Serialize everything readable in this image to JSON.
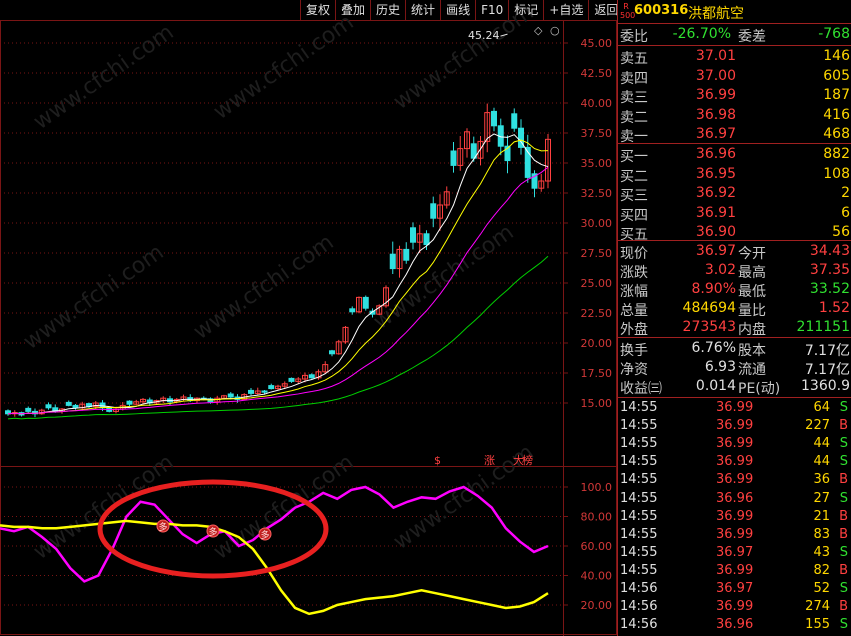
{
  "toolbar": {
    "buttons": [
      "复权",
      "叠加",
      "历史",
      "统计",
      "画线",
      "F10",
      "标记",
      "+自选",
      "返回"
    ]
  },
  "chart": {
    "price_axis": [
      "45.00",
      "42.50",
      "40.00",
      "37.50",
      "35.00",
      "32.50",
      "30.00",
      "27.50",
      "25.00",
      "22.50",
      "20.00",
      "17.50",
      "15.00"
    ],
    "indicator_axis": [
      "100.0",
      "80.00",
      "60.00",
      "40.00",
      "20.00"
    ],
    "high_label": "45.24",
    "markers": [
      "$",
      "涨",
      "大",
      "榜"
    ],
    "signal_label": "多",
    "watermark": "www.cfchi.com"
  },
  "chart_data": {
    "type": "line",
    "candle_closes": [
      14.1,
      14.2,
      14.0,
      14.3,
      14.1,
      14.4,
      14.6,
      14.3,
      14.5,
      14.8,
      14.6,
      14.9,
      14.7,
      15.0,
      14.6,
      14.3,
      14.5,
      14.8,
      14.9,
      15.1,
      15.3,
      15.0,
      15.2,
      15.4,
      15.1,
      15.3,
      15.5,
      15.2,
      15.4,
      15.3,
      15.1,
      15.4,
      15.6,
      15.5,
      15.3,
      15.7,
      15.8,
      16.0,
      15.9,
      16.2,
      16.4,
      16.6,
      16.8,
      17.0,
      17.3,
      17.1,
      17.6,
      18.2,
      19.1,
      20.1,
      21.3,
      22.6,
      23.8,
      22.9,
      22.4,
      23.1,
      24.6,
      26.2,
      27.8,
      26.9,
      28.4,
      29.1,
      28.2,
      30.4,
      31.5,
      32.6,
      34.8,
      36.2,
      37.6,
      35.4,
      36.8,
      39.2,
      38.1,
      36.4,
      35.2,
      37.9,
      36.3,
      33.8,
      32.9,
      33.5,
      36.97
    ],
    "series": [
      {
        "name": "",
        "color": "#ff00ff",
        "values": [
          72,
          70,
          73,
          66,
          58,
          45,
          36,
          40,
          58,
          80,
          90,
          88,
          78,
          68,
          62,
          68,
          70,
          60,
          64,
          72,
          78,
          86,
          90,
          96,
          92,
          98,
          100,
          95,
          86,
          90,
          93,
          92,
          97,
          100,
          94,
          86,
          72,
          63,
          56,
          60
        ]
      },
      {
        "name": "",
        "color": "#ffff00",
        "values": [
          74,
          73,
          73,
          72,
          72,
          73,
          74,
          75,
          76,
          77,
          76,
          75,
          75,
          74,
          74,
          73,
          70,
          66,
          58,
          45,
          30,
          18,
          14,
          16,
          20,
          22,
          24,
          25,
          26,
          28,
          30,
          28,
          26,
          24,
          22,
          20,
          18,
          19,
          22,
          28
        ]
      }
    ],
    "y_price_range": [
      13.0,
      46.0
    ],
    "y_indicator_range": [
      8,
      108
    ]
  },
  "stock": {
    "badge": "R 500",
    "code": "600316",
    "name": "洪都航空",
    "weibi_label": "委比",
    "weibi": "-26.70%",
    "weicha_label": "委差",
    "weicha": "-768",
    "asks": [
      {
        "label": "卖五",
        "price": "37.01",
        "vol": "146"
      },
      {
        "label": "卖四",
        "price": "37.00",
        "vol": "605"
      },
      {
        "label": "卖三",
        "price": "36.99",
        "vol": "187"
      },
      {
        "label": "卖二",
        "price": "36.98",
        "vol": "416"
      },
      {
        "label": "卖一",
        "price": "36.97",
        "vol": "468"
      }
    ],
    "bids": [
      {
        "label": "买一",
        "price": "36.96",
        "vol": "882"
      },
      {
        "label": "买二",
        "price": "36.95",
        "vol": "108"
      },
      {
        "label": "买三",
        "price": "36.92",
        "vol": "2"
      },
      {
        "label": "买四",
        "price": "36.91",
        "vol": "6"
      },
      {
        "label": "买五",
        "price": "36.90",
        "vol": "56"
      }
    ],
    "stats": [
      {
        "l1": "现价",
        "v1": "36.97",
        "l2": "今开",
        "v2": "34.43"
      },
      {
        "l1": "涨跌",
        "v1": "3.02",
        "l2": "最高",
        "v2": "37.35"
      },
      {
        "l1": "涨幅",
        "v1": "8.90%",
        "l2": "最低",
        "v2": "33.52"
      },
      {
        "l1": "总量",
        "v1": "484694",
        "l2": "量比",
        "v2": "1.52"
      },
      {
        "l1": "外盘",
        "v1": "273543",
        "l2": "内盘",
        "v2": "211151"
      }
    ],
    "stats2": [
      {
        "l1": "换手",
        "v1": "6.76%",
        "l2": "股本",
        "v2": "7.17亿"
      },
      {
        "l1": "净资",
        "v1": "6.93",
        "l2": "流通",
        "v2": "7.17亿"
      },
      {
        "l1": "收益㈢",
        "v1": "0.014",
        "l2": "PE(动)",
        "v2": "1360.9"
      }
    ]
  },
  "ticks": [
    {
      "time": "14:55",
      "price": "36.99",
      "vol": "64",
      "side": "S"
    },
    {
      "time": "14:55",
      "price": "36.99",
      "vol": "227",
      "side": "B"
    },
    {
      "time": "14:55",
      "price": "36.99",
      "vol": "44",
      "side": "S"
    },
    {
      "time": "14:55",
      "price": "36.99",
      "vol": "44",
      "side": "S"
    },
    {
      "time": "14:55",
      "price": "36.99",
      "vol": "36",
      "side": "B"
    },
    {
      "time": "14:55",
      "price": "36.96",
      "vol": "27",
      "side": "S"
    },
    {
      "time": "14:55",
      "price": "36.99",
      "vol": "21",
      "side": "B"
    },
    {
      "time": "14:55",
      "price": "36.99",
      "vol": "83",
      "side": "B"
    },
    {
      "time": "14:55",
      "price": "36.97",
      "vol": "43",
      "side": "S"
    },
    {
      "time": "14:55",
      "price": "36.99",
      "vol": "82",
      "side": "B"
    },
    {
      "time": "14:56",
      "price": "36.97",
      "vol": "52",
      "side": "S"
    },
    {
      "time": "14:56",
      "price": "36.99",
      "vol": "274",
      "side": "B"
    },
    {
      "time": "14:56",
      "price": "36.96",
      "vol": "155",
      "side": "S"
    }
  ],
  "colors": {
    "up": "#ff4040",
    "down": "#30e0e0",
    "grid": "#7a1515",
    "ma5": "#ffffff",
    "ma10": "#ffff00",
    "ma20": "#ff00ff",
    "ma60": "#00d000",
    "circle": "#e82020"
  }
}
